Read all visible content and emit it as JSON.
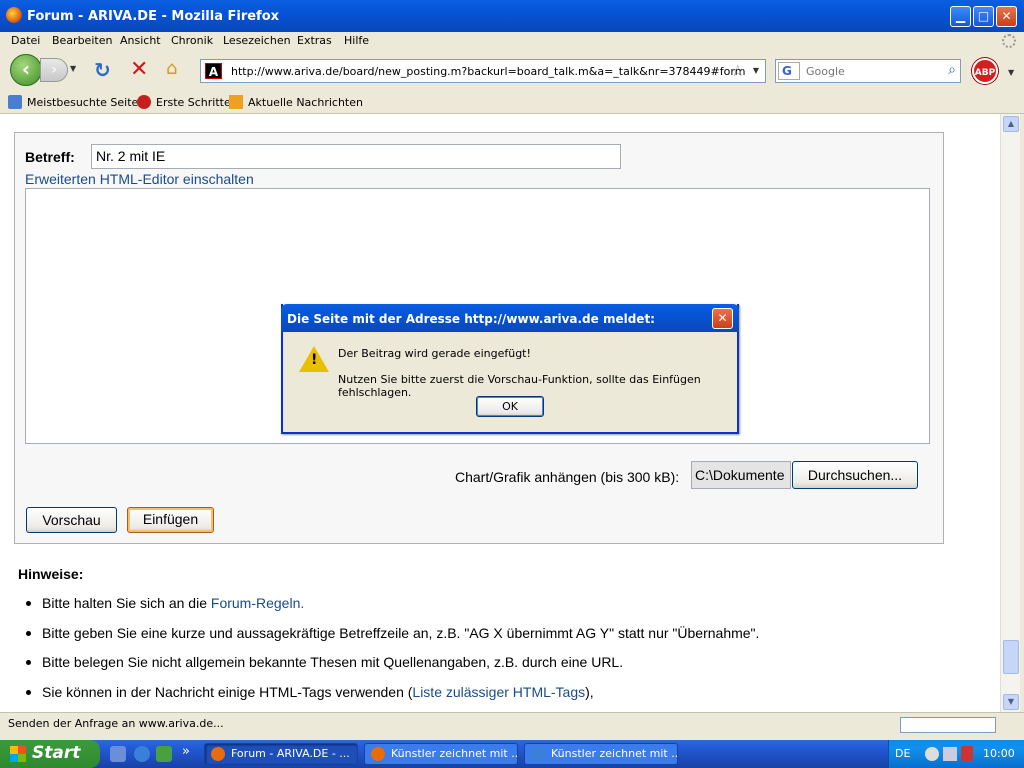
{
  "window": {
    "title": "Forum - ARIVA.DE - Mozilla Firefox"
  },
  "menu": [
    "Datei",
    "Bearbeiten",
    "Ansicht",
    "Chronik",
    "Lesezeichen",
    "Extras",
    "Hilfe"
  ],
  "nav": {
    "url": "http://www.ariva.de/board/new_posting.m?backurl=board_talk.m&a=_talk&nr=378449#form",
    "search_placeholder": "Google",
    "search_engine_glyph": "G",
    "site_icon": "A",
    "abp": "ABP"
  },
  "bookmarks": [
    "Meistbesuchte Seiten",
    "Erste Schritte",
    "Aktuelle Nachrichten"
  ],
  "form": {
    "subject_label": "Betreff:",
    "subject_value": "Nr. 2 mit IE",
    "editor_link": "Erweiterten HTML-Editor einschalten",
    "attach_label": "Chart/Grafik anhängen (bis 300 kB):",
    "file_value": "C:\\Dokumente",
    "browse_label": "Durchsuchen...",
    "preview_label": "Vorschau",
    "insert_label": "Einfügen"
  },
  "hints": {
    "title": "Hinweise:",
    "items": [
      {
        "before": "Bitte halten Sie sich an die ",
        "link": "Forum-Regeln.",
        "after": ""
      },
      {
        "before": "Bitte geben Sie eine kurze und aussagekräftige Betreffzeile an, z.B. \"AG X übernimmt AG Y\" statt nur \"Übernahme\".",
        "link": "",
        "after": ""
      },
      {
        "before": "Bitte belegen Sie nicht allgemein bekannte Thesen mit Quellenangaben, z.B. durch eine URL.",
        "link": "",
        "after": ""
      },
      {
        "before": "Sie können in der Nachricht einige HTML-Tags verwenden (",
        "link": "Liste zulässiger HTML-Tags",
        "after": "),"
      }
    ]
  },
  "status": {
    "text": "Senden der Anfrage an www.ariva.de..."
  },
  "dialog": {
    "title": "Die Seite mit der Adresse http://www.ariva.de meldet:",
    "message1": "Der Beitrag wird gerade eingefügt!",
    "message2": "Nutzen Sie bitte zuerst die Vorschau-Funktion, sollte das Einfügen fehlschlagen.",
    "ok": "OK"
  },
  "taskbar": {
    "start": "Start",
    "overflow": "»",
    "tasks": [
      "Forum - ARIVA.DE - ...",
      "Künstler zeichnet mit ...",
      "Künstler zeichnet mit ..."
    ],
    "lang": "DE",
    "clock": "10:00"
  },
  "colors": {
    "link": "#1a4b8c",
    "titlebar": "#0653d6",
    "taskbar": "#245edb",
    "start": "#2f8a2f"
  }
}
